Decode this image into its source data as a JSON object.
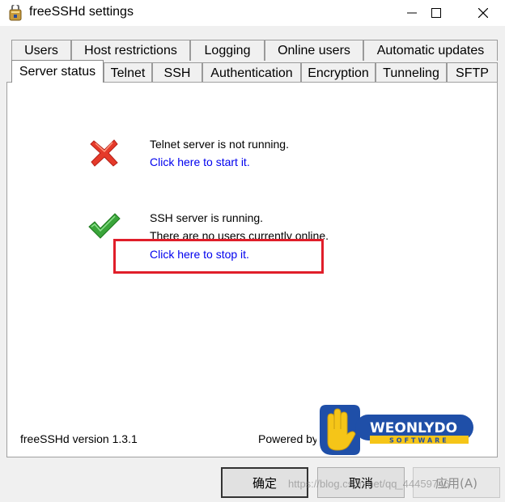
{
  "window": {
    "title": "freeSSHd settings"
  },
  "tabs_row1": [
    {
      "label": "Users"
    },
    {
      "label": "Host restrictions"
    },
    {
      "label": "Logging"
    },
    {
      "label": "Online users"
    },
    {
      "label": "Automatic updates"
    }
  ],
  "tabs_row2": [
    {
      "label": "Server status",
      "active": true
    },
    {
      "label": "Telnet"
    },
    {
      "label": "SSH"
    },
    {
      "label": "Authentication"
    },
    {
      "label": "Encryption"
    },
    {
      "label": "Tunneling"
    },
    {
      "label": "SFTP"
    }
  ],
  "telnet": {
    "status": "Telnet server is not running.",
    "action": "Click here to start it.",
    "icon": "error-x-icon"
  },
  "ssh": {
    "status": "SSH server is running.",
    "users": "There are no users currently online.",
    "action": "Click here to stop it.",
    "icon": "checkmark-icon"
  },
  "footer": {
    "version": "freeSSHd version 1.3.1",
    "powered_by": "Powered by",
    "logo_brand": "WEONLYDO",
    "logo_sub": "SOFTWARE"
  },
  "buttons": {
    "ok": "确定",
    "cancel": "取消",
    "apply": "应用(A)"
  },
  "watermark": "https://blog.csdn.net/qq_44459746",
  "colors": {
    "link": "#0000ee",
    "highlight": "#e01e2a",
    "check_green": "#3aa53a",
    "error_red": "#e53a2a",
    "logo_blue": "#1f4fa8",
    "logo_yellow": "#f5c518"
  }
}
